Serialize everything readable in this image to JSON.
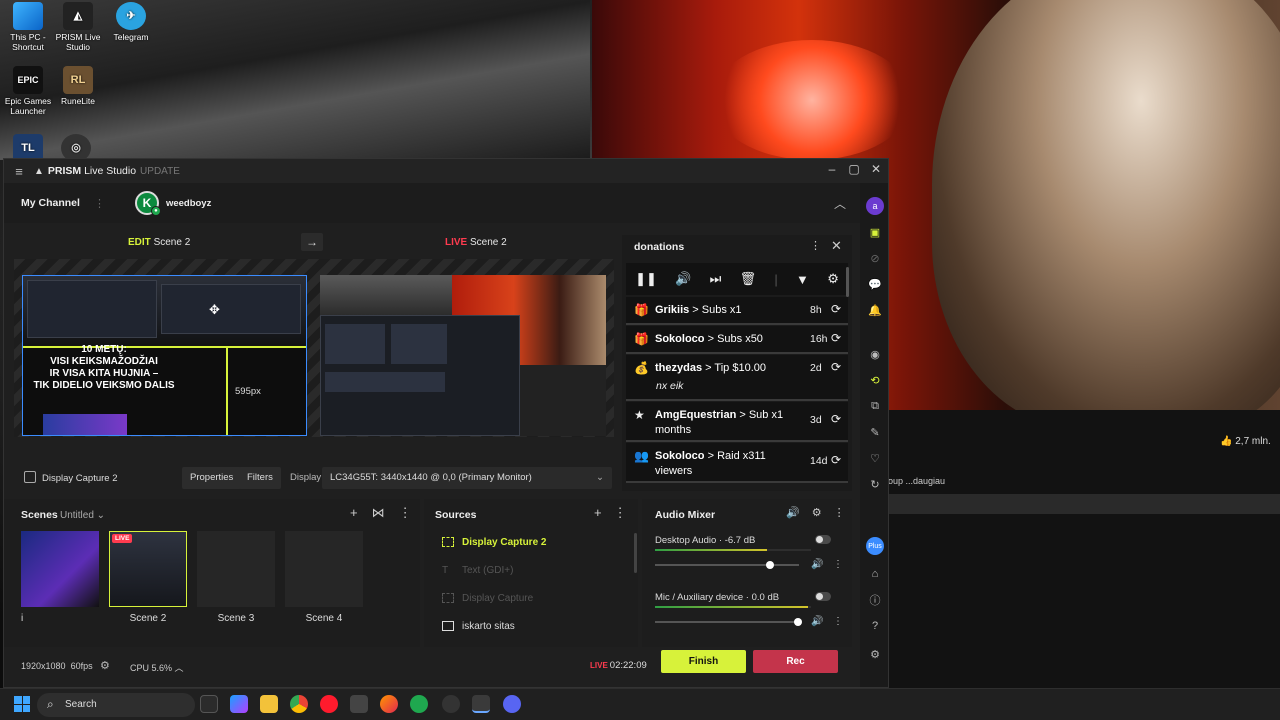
{
  "desktop": {
    "icons": [
      {
        "label": "This PC - Shortcut",
        "glyph": "💻"
      },
      {
        "label": "PRISM Live Studio",
        "glyph": "◭"
      },
      {
        "label": "Telegram",
        "glyph": "✈"
      },
      {
        "label": "Epic Games Launcher",
        "glyph": "EPIC"
      },
      {
        "label": "RuneLite",
        "glyph": "RL"
      }
    ],
    "video": {
      "likes": "2,7 mln.",
      "caption": "oup ...daugiau"
    }
  },
  "window": {
    "app_name_bold": "PRISM",
    "app_name_rest": "Live Studio",
    "update_label": "UPDATE"
  },
  "channel": {
    "title": "My Channel",
    "avatar_letter": "K",
    "username": "weedboyz"
  },
  "preview": {
    "edit_tag": "EDIT",
    "edit_scene": "Scene 2",
    "live_tag": "LIVE",
    "live_scene": "Scene 2",
    "overlay_text_1": "10 METŲ:",
    "overlay_text_2": "VISI KEIKSMAŽODŽIAI",
    "overlay_text_3": "IR VISA KITA HUJNIA –",
    "overlay_text_4": "TIK DIDELIO VEIKSMO DALIS",
    "px_readout": "595px"
  },
  "toolbar": {
    "source_name": "Display Capture 2",
    "properties": "Properties",
    "filters": "Filters",
    "display_label": "Display",
    "display_value": "LC34G55T: 3440x1440 @ 0,0 (Primary Monitor)"
  },
  "donations": {
    "title": "donations",
    "items": [
      {
        "user": "Grikiis",
        "detail": "Subs x1",
        "time": "8h",
        "note": ""
      },
      {
        "user": "Sokoloco",
        "detail": "Subs x50",
        "time": "16h",
        "note": ""
      },
      {
        "user": "thezydas",
        "detail": "Tip $10.00",
        "time": "2d",
        "note": "nx eik"
      },
      {
        "user": "AmgEquestrian",
        "detail": "Sub x1 months",
        "time": "3d",
        "note": ""
      },
      {
        "user": "Sokoloco",
        "detail": "Raid x311 viewers",
        "time": "14d",
        "note": ""
      }
    ]
  },
  "scenes": {
    "title": "Scenes",
    "collection": "Untitled",
    "live_badge": "LIVE",
    "items": [
      {
        "label": "i"
      },
      {
        "label": "Scene 2"
      },
      {
        "label": "Scene 3"
      },
      {
        "label": "Scene 4"
      }
    ]
  },
  "sources": {
    "title": "Sources",
    "items": [
      {
        "label": "Display Capture 2",
        "state": "selected"
      },
      {
        "label": "Text (GDI+)",
        "state": "hidden"
      },
      {
        "label": "Display Capture",
        "state": "hidden"
      },
      {
        "label": "iskarto sitas",
        "state": "normal"
      }
    ]
  },
  "mixer": {
    "title": "Audio Mixer",
    "channels": [
      {
        "name": "Desktop Audio",
        "db": "-6.7 dB",
        "level": 0.72,
        "volume": 0.8
      },
      {
        "name": "Mic / Auxiliary device",
        "db": "0.0 dB",
        "level": 0.98,
        "volume": 0.99
      }
    ]
  },
  "status": {
    "resolution": "1920x1080",
    "fps": "60fps",
    "cpu": "CPU 5.6%",
    "live_tag": "LIVE",
    "timer": "02:22:09",
    "finish": "Finish",
    "rec": "Rec"
  },
  "taskbar": {
    "search": "Search"
  },
  "colors": {
    "accent": "#d7f23a",
    "live_red": "#ff3b4f",
    "rec": "#c4344b",
    "selection_blue": "#3b8cff"
  }
}
